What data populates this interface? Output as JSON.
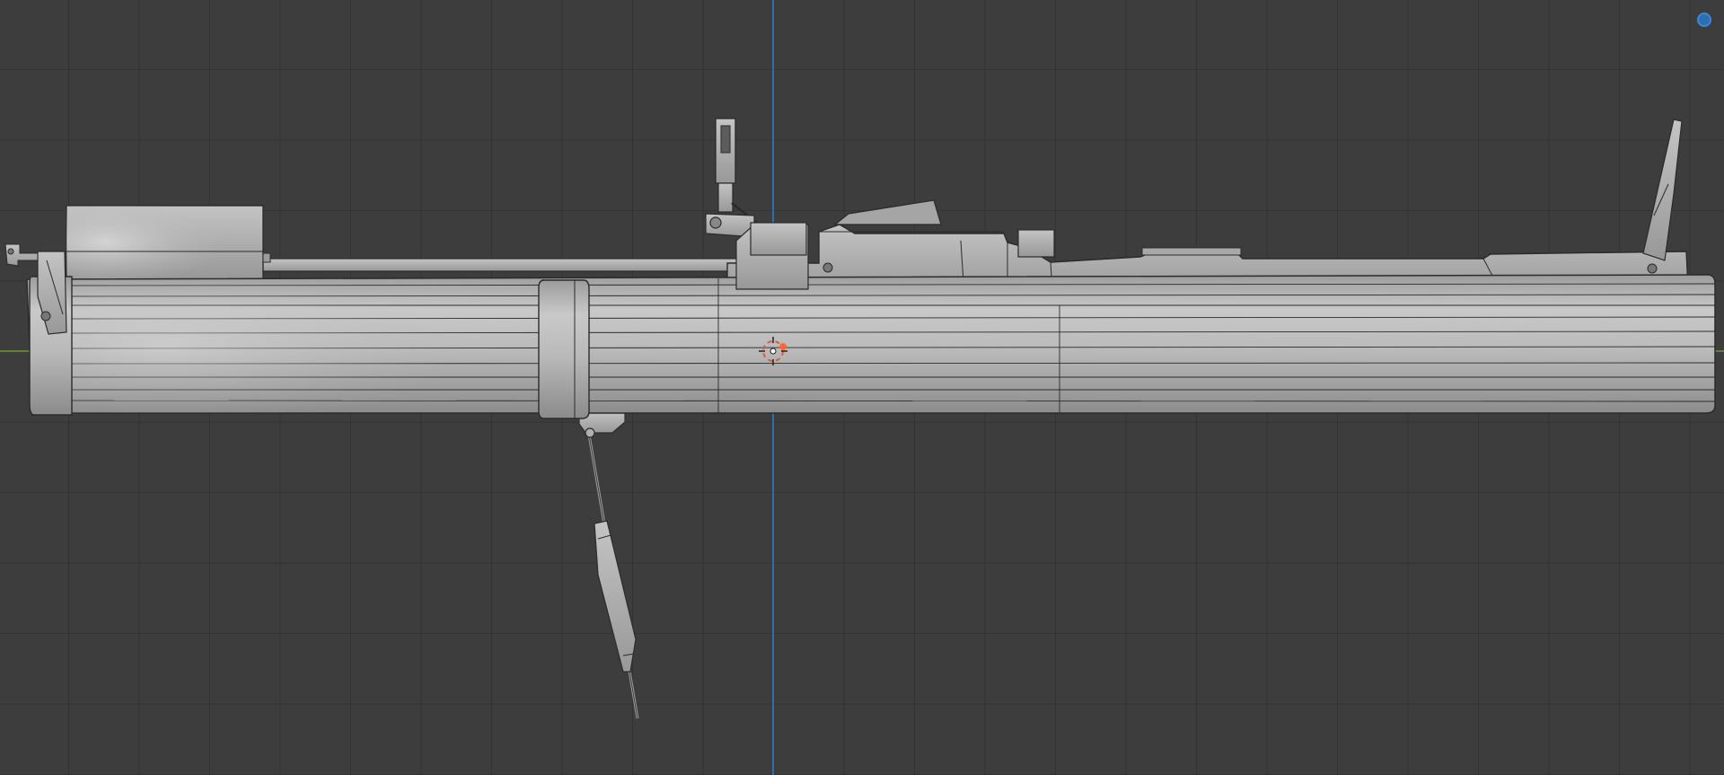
{
  "viewport": {
    "mode": "orthographic-side",
    "background": "#3d3d3d",
    "grid_color": "#333333",
    "axis_colors": {
      "x": "#6e9a3b",
      "z": "#2f6ea8"
    },
    "model": {
      "name": "",
      "shading": "solid-gray",
      "base_color": "#b7b7b7",
      "edge_color": "#2b2b2b",
      "components": [
        "launch-tube",
        "rear-end-cap",
        "sight-box",
        "rod",
        "front-sight-post",
        "optic-mount",
        "muzzle-sight",
        "tube-clamp-ring",
        "sling-swivel",
        "sling-weight"
      ]
    },
    "origin_icon": "3d-cursor-icon",
    "gizmo_icon": "navigation-gizmo-icon"
  }
}
